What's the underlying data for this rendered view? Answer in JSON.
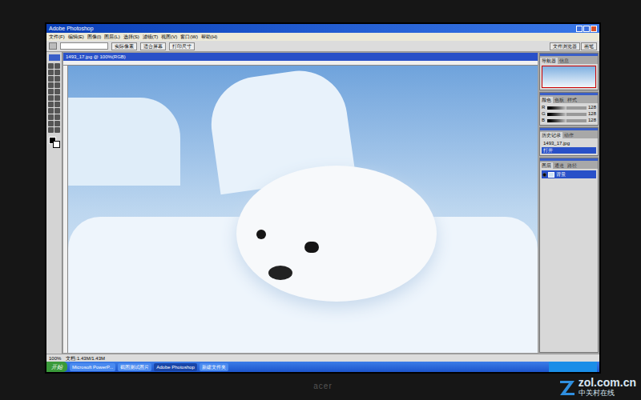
{
  "window": {
    "title": "Adobe Photoshop"
  },
  "menu": [
    "文件(F)",
    "编辑(E)",
    "图像(I)",
    "图层(L)",
    "选择(S)",
    "滤镜(T)",
    "视图(V)",
    "窗口(W)",
    "帮助(H)"
  ],
  "options_bar": {
    "buttons": [
      {
        "label": "实际像素",
        "selected": false
      },
      {
        "label": "适合屏幕",
        "selected": false
      },
      {
        "label": "打印尺寸",
        "selected": false
      }
    ],
    "tabs": [
      {
        "label": "文件浏览器",
        "selected": false
      },
      {
        "label": "画笔",
        "selected": false
      }
    ]
  },
  "document": {
    "title": "1493_17.jpg @ 100%(RGB)"
  },
  "panels": {
    "navigator": {
      "tabs": [
        {
          "label": "导航器",
          "selected": true
        },
        {
          "label": "信息",
          "selected": false
        }
      ]
    },
    "color": {
      "tabs": [
        {
          "label": "颜色",
          "selected": true
        },
        {
          "label": "色板",
          "selected": false
        },
        {
          "label": "样式",
          "selected": false
        }
      ],
      "channels": [
        {
          "label": "R",
          "level": 0.5,
          "reading": "128"
        },
        {
          "label": "G",
          "level": 0.5,
          "reading": "128"
        },
        {
          "label": "B",
          "level": 0.5,
          "reading": "128"
        }
      ]
    },
    "history": {
      "tabs": [
        {
          "label": "历史记录",
          "selected": true
        },
        {
          "label": "动作",
          "selected": false
        }
      ],
      "items": [
        {
          "label": "1493_17.jpg",
          "selected": false
        },
        {
          "label": "打开",
          "selected": true
        }
      ]
    },
    "layers": {
      "tabs": [
        {
          "label": "图层",
          "selected": true
        },
        {
          "label": "通道",
          "selected": false
        },
        {
          "label": "路径",
          "selected": false
        }
      ],
      "items": [
        {
          "label": "背景",
          "selected": true,
          "visible": true
        }
      ]
    }
  },
  "status_bar": {
    "zoom": "100%",
    "text": "文档:1.43M/1.43M"
  },
  "taskbar": {
    "start": "开始",
    "items": [
      {
        "label": "Microsoft PowerP...",
        "selected": false
      },
      {
        "label": "截图测试图片",
        "selected": false
      },
      {
        "label": "Adobe Photoshop",
        "selected": true
      },
      {
        "label": "新建文件夹",
        "selected": false
      }
    ]
  },
  "monitor": {
    "brand": "acer"
  },
  "watermark": {
    "site": "zol.com.cn",
    "name": "中关村在线"
  }
}
